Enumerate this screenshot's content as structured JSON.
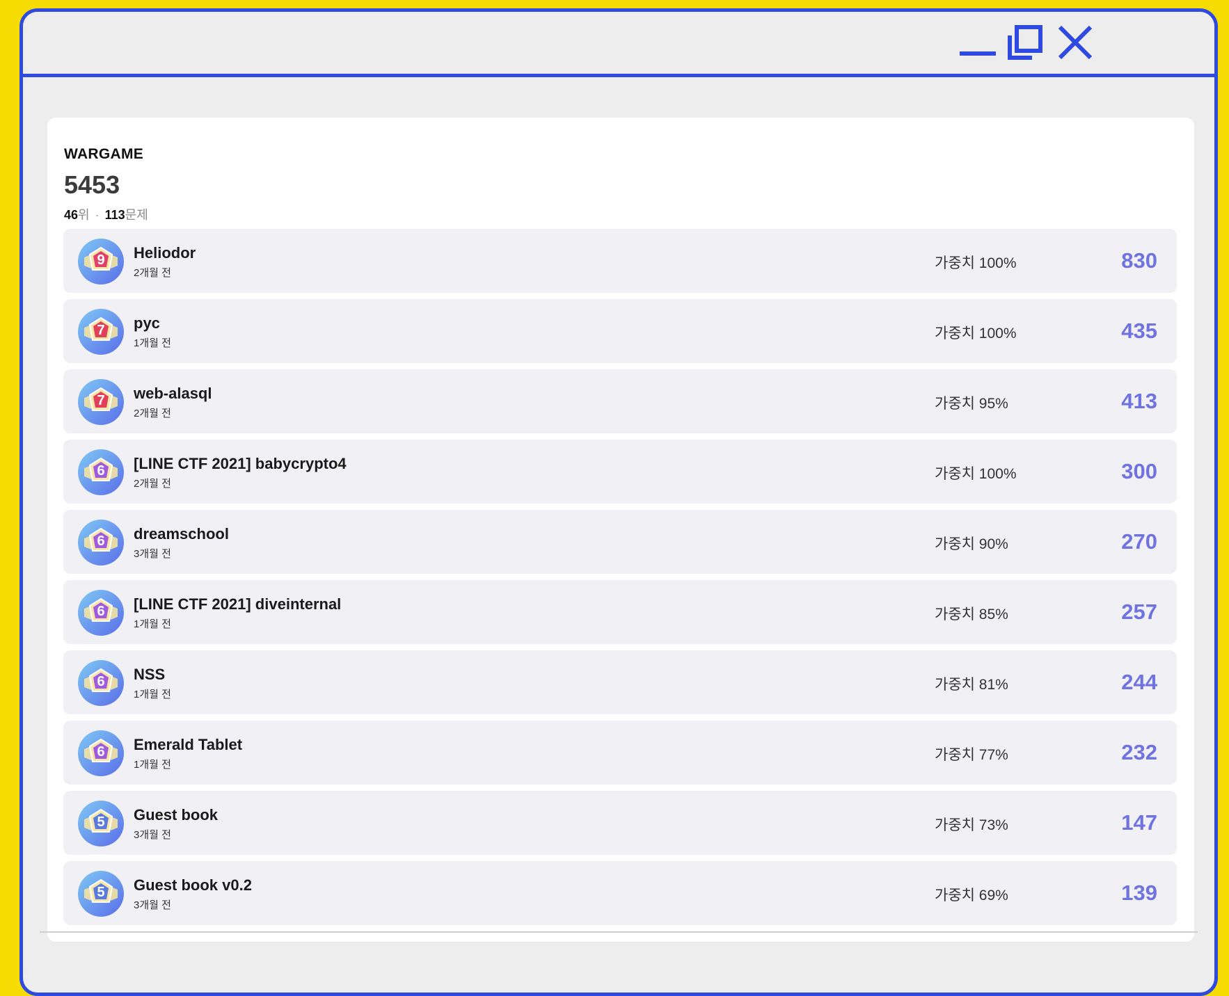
{
  "window": {
    "controls": [
      "minimize-icon",
      "restore-icon",
      "close-icon"
    ],
    "accent_color": "#2e4ae0",
    "backdrop_color": "#f7dc03"
  },
  "profile": {
    "section_label": "WARGAME",
    "score": "5453",
    "rank": "46",
    "rank_unit": "위",
    "separator": "·",
    "solved": "113",
    "solved_unit": "문제"
  },
  "problems": [
    {
      "title": "Heliodor",
      "time": "2개월 전",
      "weight": "가중치 100%",
      "points": "830",
      "level": "9",
      "badge_color": "#e0406a"
    },
    {
      "title": "pyc",
      "time": "1개월 전",
      "weight": "가중치 100%",
      "points": "435",
      "level": "7",
      "badge_color": "#e0405a"
    },
    {
      "title": "web-alasql",
      "time": "2개월 전",
      "weight": "가중치 95%",
      "points": "413",
      "level": "7",
      "badge_color": "#e0405a"
    },
    {
      "title": "[LINE CTF 2021] babycrypto4",
      "time": "2개월 전",
      "weight": "가중치 100%",
      "points": "300",
      "level": "6",
      "badge_color": "#a05ae0"
    },
    {
      "title": "dreamschool",
      "time": "3개월 전",
      "weight": "가중치 90%",
      "points": "270",
      "level": "6",
      "badge_color": "#a05ae0"
    },
    {
      "title": "[LINE CTF 2021] diveinternal",
      "time": "1개월 전",
      "weight": "가중치 85%",
      "points": "257",
      "level": "6",
      "badge_color": "#a05ae0"
    },
    {
      "title": "NSS",
      "time": "1개월 전",
      "weight": "가중치 81%",
      "points": "244",
      "level": "6",
      "badge_color": "#a05ae0"
    },
    {
      "title": "Emerald Tablet",
      "time": "1개월 전",
      "weight": "가중치 77%",
      "points": "232",
      "level": "6",
      "badge_color": "#a05ae0"
    },
    {
      "title": "Guest book",
      "time": "3개월 전",
      "weight": "가중치 73%",
      "points": "147",
      "level": "5",
      "badge_color": "#5a7ae0"
    },
    {
      "title": "Guest book v0.2",
      "time": "3개월 전",
      "weight": "가중치 69%",
      "points": "139",
      "level": "5",
      "badge_color": "#5a7ae0"
    }
  ],
  "points_color": "#6e73e0"
}
